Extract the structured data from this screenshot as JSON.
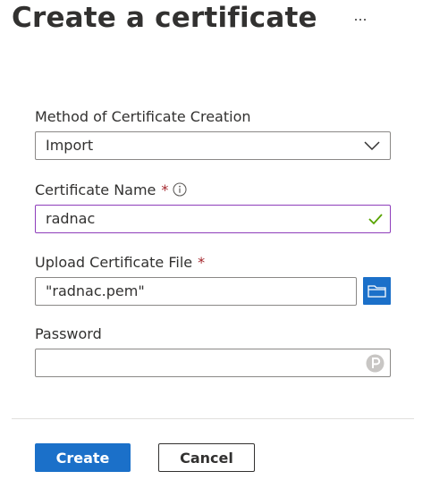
{
  "header": {
    "title": "Create a certificate",
    "more_icon": "ellipsis-icon"
  },
  "form": {
    "method": {
      "label": "Method of Certificate Creation",
      "value": "Import"
    },
    "certificate_name": {
      "label": "Certificate Name",
      "required_mark": "*",
      "value": "radnac",
      "valid": true
    },
    "upload_file": {
      "label": "Upload Certificate File",
      "required_mark": "*",
      "value": "\"radnac.pem\""
    },
    "password": {
      "label": "Password",
      "value": ""
    }
  },
  "actions": {
    "create_label": "Create",
    "cancel_label": "Cancel"
  },
  "colors": {
    "primary": "#1b70c9",
    "focus_border": "#8e3dbb",
    "valid_check": "#57a300",
    "required": "#a4262c"
  }
}
